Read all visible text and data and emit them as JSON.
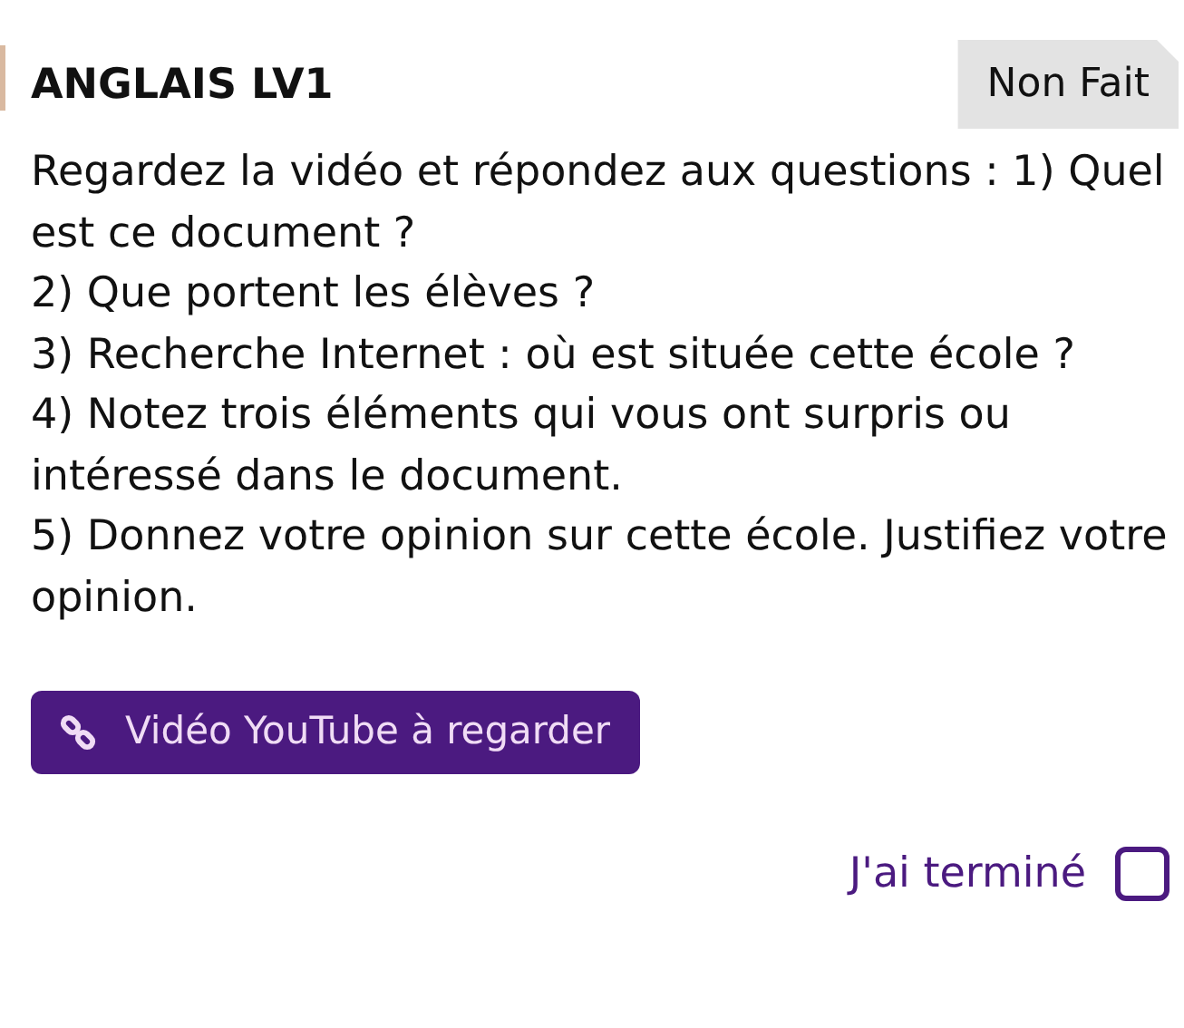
{
  "homework": {
    "subject": "ANGLAIS LV1",
    "status": "Non Fait",
    "instructions": "Regardez la vidéo et répondez aux questions : 1) Quel est ce document ?\n2) Que portent les élèves ?\n3) Recherche Internet : où est située cette école ?\n4) Notez trois éléments qui vous ont surpris ou intéressé dans le document.\n5) Donnez votre opinion sur cette école. Justifiez votre opinion.",
    "link": {
      "label": "Vidéo YouTube à regarder"
    },
    "done": {
      "label": "J'ai terminé",
      "checked": false
    }
  }
}
